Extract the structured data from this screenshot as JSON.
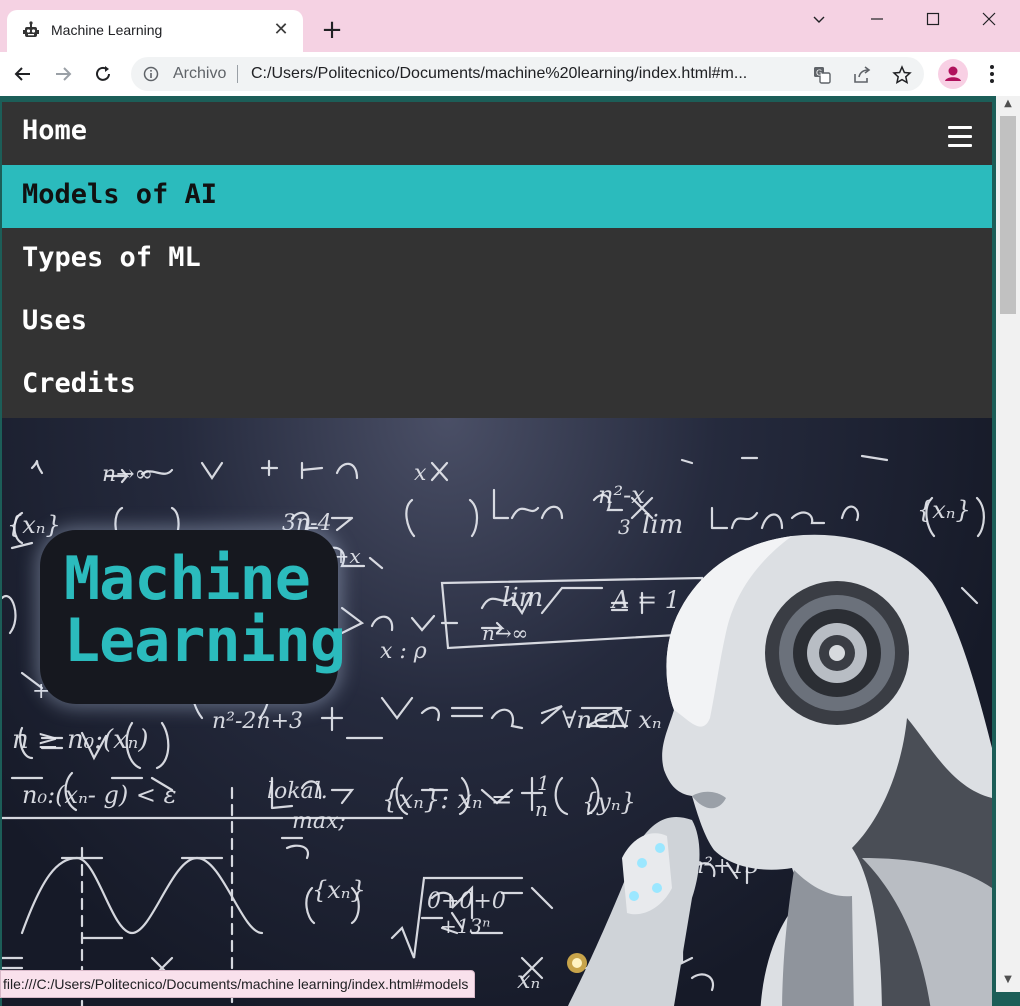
{
  "browser": {
    "tab": {
      "title": "Machine Learning",
      "favicon": "robot-icon"
    },
    "new_tab_label": "+",
    "address": {
      "origin_label": "Archivo",
      "url": "C:/Users/Politecnico/Documents/machine%20learning/index.html#m..."
    },
    "icons": [
      "back-icon",
      "forward-icon",
      "reload-icon",
      "info-icon",
      "translate-icon",
      "share-icon",
      "star-icon",
      "profile-icon",
      "menu-dots-icon"
    ],
    "status_url": "file:///C:/Users/Politecnico/Documents/machine learning/index.html#models"
  },
  "nav": {
    "home": "Home",
    "items": [
      "Models of AI",
      "Types of ML",
      "Uses",
      "Credits"
    ],
    "active_index": 0,
    "accent_color": "#2bbbbd",
    "background_color": "#333333"
  },
  "hero": {
    "title_line1": "Machine",
    "title_line2": "Learning"
  }
}
